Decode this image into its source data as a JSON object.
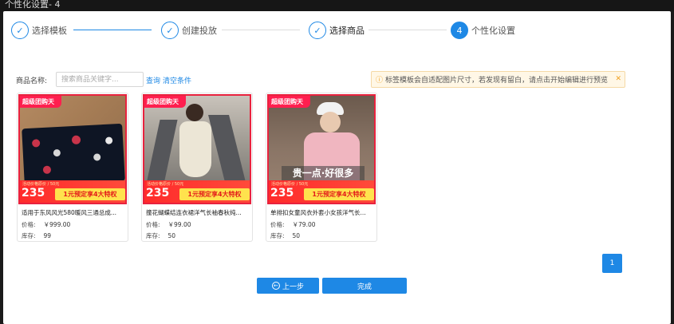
{
  "window": {
    "title": "个性化设置- 4"
  },
  "steps": [
    {
      "label": "选择模板",
      "state": "done",
      "icon": "check-icon"
    },
    {
      "label": "创建投放",
      "state": "done",
      "icon": "check-icon"
    },
    {
      "label": "选择商品",
      "state": "done",
      "icon": "check-icon"
    },
    {
      "label": "个性化设置",
      "state": "active",
      "number": "4"
    }
  ],
  "filter": {
    "label": "商品名称:",
    "placeholder": "搜索商品关键字...",
    "search_link": "查询",
    "clear_link": "清空条件"
  },
  "notice": {
    "icon": "info-icon",
    "text": "标签模板会自适配图片尺寸，若发现有留白，请点击开始编辑进行预览",
    "close": "✕"
  },
  "products": [
    {
      "badge": "超级团购天",
      "promo_small": "活动价格原价 / 50元",
      "promo_price": "235",
      "promo_tag": "1元预定享4大特权",
      "slogan": "",
      "title": "适用于东风风光580暖风三通总成...",
      "price_label": "价格:",
      "price": "￥999.00",
      "stock_label": "库存:",
      "stock": "99"
    },
    {
      "badge": "超级团购天",
      "promo_small": "活动价格原价 / 50元",
      "promo_price": "235",
      "promo_tag": "1元预定享4大特权",
      "slogan": "",
      "title": "撞花蝴蝶结连衣裙洋气长袖春秋纯...",
      "price_label": "价格:",
      "price": "￥99.00",
      "stock_label": "库存:",
      "stock": "50"
    },
    {
      "badge": "超级团购天",
      "promo_small": "活动价格原价 / 50元",
      "promo_price": "235",
      "promo_tag": "1元预定享4大特权",
      "slogan": "贵一点·好很多",
      "title": "单排扣女童风衣外套小女孩洋气长...",
      "price_label": "价格:",
      "price": "￥79.00",
      "stock_label": "库存:",
      "stock": "50"
    }
  ],
  "pagination": {
    "current": "1"
  },
  "actions": {
    "prev": "上一步",
    "finish": "完成"
  },
  "colors": {
    "primary": "#1e88e5",
    "promo_red": "#ff2b2b",
    "promo_yellow": "#ffe24d",
    "notice_bg": "#fff7e6"
  }
}
